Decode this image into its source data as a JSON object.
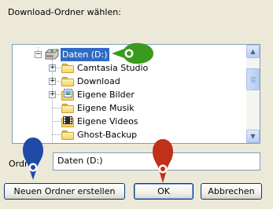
{
  "dialog": {
    "header_label": "Download-Ordner wählen:"
  },
  "tree": {
    "root": {
      "label": "Daten (D:)",
      "expander": "−",
      "icon": "drive-icon"
    },
    "children": [
      {
        "label": "Camtasia Studio",
        "expander": "+",
        "icon": "folder-icon"
      },
      {
        "label": "Download",
        "expander": "+",
        "icon": "folder-icon"
      },
      {
        "label": "Eigene Bilder",
        "expander": "+",
        "icon": "pictures-folder-icon"
      },
      {
        "label": "Eigene Musik",
        "expander": "",
        "icon": "folder-icon"
      },
      {
        "label": "Eigene Videos",
        "expander": "",
        "icon": "video-folder-icon"
      },
      {
        "label": "Ghost-Backup",
        "expander": "",
        "icon": "folder-icon"
      }
    ],
    "scroll_up": "▲",
    "scroll_down": "▼"
  },
  "folder_name": {
    "label": "Ordner",
    "value": "Daten (D:)"
  },
  "buttons": {
    "new_folder": "Neuen Ordner erstellen",
    "ok": "OK",
    "cancel": "Abbrechen"
  },
  "pins": {
    "green": "#3a9a1e",
    "blue": "#1f4aa8",
    "red": "#c0301a"
  }
}
